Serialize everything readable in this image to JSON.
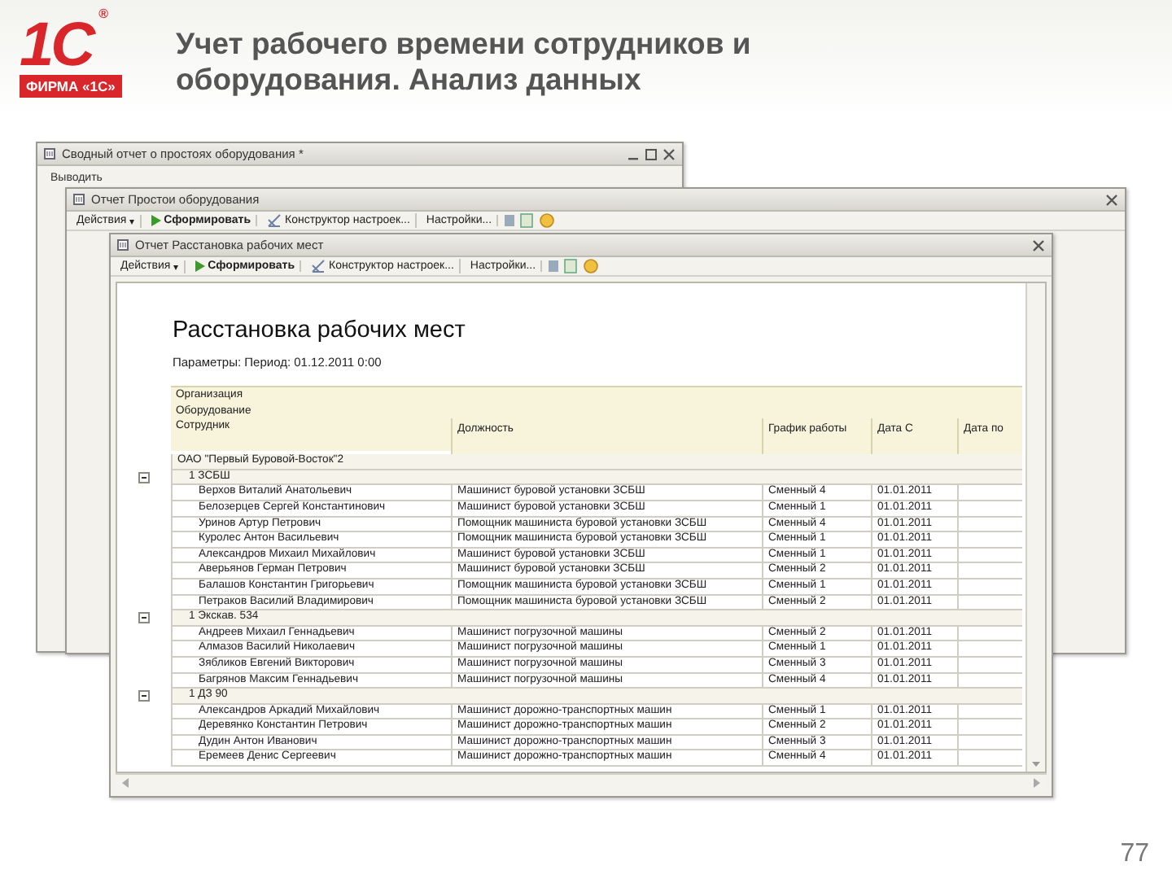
{
  "slide": {
    "logo": {
      "mark": "1С",
      "registered": "®",
      "caption": "ФИРМА «1С»"
    },
    "title": "Учет рабочего времени сотрудников и оборудования. Анализ данных",
    "page_number": "77"
  },
  "windows": [
    {
      "title": "Сводный отчет о простоях оборудования *",
      "side_label": "Выводить"
    },
    {
      "title": "Отчет  Простои оборудования",
      "toolbar": [
        {
          "kind": "menu",
          "label": "Действия",
          "caret": "▾"
        },
        {
          "kind": "run",
          "label": "Сформировать"
        },
        {
          "kind": "designer",
          "label": "Конструктор настроек..."
        },
        {
          "kind": "settings",
          "label": "Настройки..."
        }
      ]
    },
    {
      "title": "Отчет  Расстановка рабочих мест",
      "toolbar": [
        {
          "kind": "menu",
          "label": "Действия",
          "caret": "▾"
        },
        {
          "kind": "run",
          "label": "Сформировать"
        },
        {
          "kind": "designer",
          "label": "Конструктор настроек..."
        },
        {
          "kind": "settings",
          "label": "Настройки..."
        }
      ],
      "report": {
        "title": "Расстановка рабочих мест",
        "parameters": "Параметры:   Период: 01.12.2011 0:00",
        "header": {
          "group_1": "Организация",
          "group_2": "Оборудование",
          "columns": [
            "Сотрудник",
            "Должность",
            "График работы",
            "Дата С",
            "Дата по"
          ]
        },
        "rows": [
          {
            "organization": "ОАО \"Первый Буровой-Восток\"2",
            "children": [
              {
                "equipment": "1 ЗСБШ",
                "children": [
                  {
                    "employee": "Верхов Виталий Анатольевич",
                    "position": "Машинист буровой установки ЗСБШ",
                    "schedule": "Сменный 4",
                    "date_from": "01.01.2011"
                  },
                  {
                    "employee": "Белозерцев Сергей Константинович",
                    "position": "Машинист буровой установки ЗСБШ",
                    "schedule": "Сменный 1",
                    "date_from": "01.01.2011"
                  },
                  {
                    "employee": "Уринов Артур Петрович",
                    "position": "Помощник машиниста буровой установки ЗСБШ",
                    "schedule": "Сменный 4",
                    "date_from": "01.01.2011"
                  },
                  {
                    "employee": "Куролес Антон Васильевич",
                    "position": "Помощник машиниста буровой установки ЗСБШ",
                    "schedule": "Сменный 1",
                    "date_from": "01.01.2011"
                  },
                  {
                    "employee": "Александров Михаил Михайлович",
                    "position": "Машинист буровой установки ЗСБШ",
                    "schedule": "Сменный 1",
                    "date_from": "01.01.2011"
                  },
                  {
                    "employee": "Аверьянов Герман Петрович",
                    "position": "Машинист буровой установки ЗСБШ",
                    "schedule": "Сменный 2",
                    "date_from": "01.01.2011"
                  },
                  {
                    "employee": "Балашов Константин Григорьевич",
                    "position": "Помощник машиниста буровой установки ЗСБШ",
                    "schedule": "Сменный 1",
                    "date_from": "01.01.2011"
                  },
                  {
                    "employee": "Петраков Василий Владимирович",
                    "position": "Помощник машиниста буровой установки ЗСБШ",
                    "schedule": "Сменный 2",
                    "date_from": "01.01.2011"
                  }
                ]
              },
              {
                "equipment": "1 Экскав. 534",
                "children": [
                  {
                    "employee": "Андреев Михаил Геннадьевич",
                    "position": "Машинист погрузочной машины",
                    "schedule": "Сменный 2",
                    "date_from": "01.01.2011"
                  },
                  {
                    "employee": "Алмазов Василий Николаевич",
                    "position": "Машинист погрузочной машины",
                    "schedule": "Сменный 1",
                    "date_from": "01.01.2011"
                  },
                  {
                    "employee": "Зябликов Евгений Викторович",
                    "position": "Машинист погрузочной машины",
                    "schedule": "Сменный 3",
                    "date_from": "01.01.2011"
                  },
                  {
                    "employee": "Багрянов Максим Геннадьевич",
                    "position": "Машинист погрузочной машины",
                    "schedule": "Сменный 4",
                    "date_from": "01.01.2011"
                  }
                ]
              },
              {
                "equipment": "1 ДЗ 90",
                "children": [
                  {
                    "employee": "Александров Аркадий Михайлович",
                    "position": "Машинист дорожно-транспортных машин",
                    "schedule": "Сменный 1",
                    "date_from": "01.01.2011"
                  },
                  {
                    "employee": "Деревянко Константин Петрович",
                    "position": "Машинист дорожно-транспортных машин",
                    "schedule": "Сменный 2",
                    "date_from": "01.01.2011"
                  },
                  {
                    "employee": "Дудин Антон Иванович",
                    "position": "Машинист дорожно-транспортных машин",
                    "schedule": "Сменный 3",
                    "date_from": "01.01.2011"
                  },
                  {
                    "employee": "Еремеев Денис Сергеевич",
                    "position": "Машинист дорожно-транспортных машин",
                    "schedule": "Сменный 4",
                    "date_from": "01.01.2011"
                  }
                ]
              }
            ]
          }
        ]
      }
    }
  ]
}
